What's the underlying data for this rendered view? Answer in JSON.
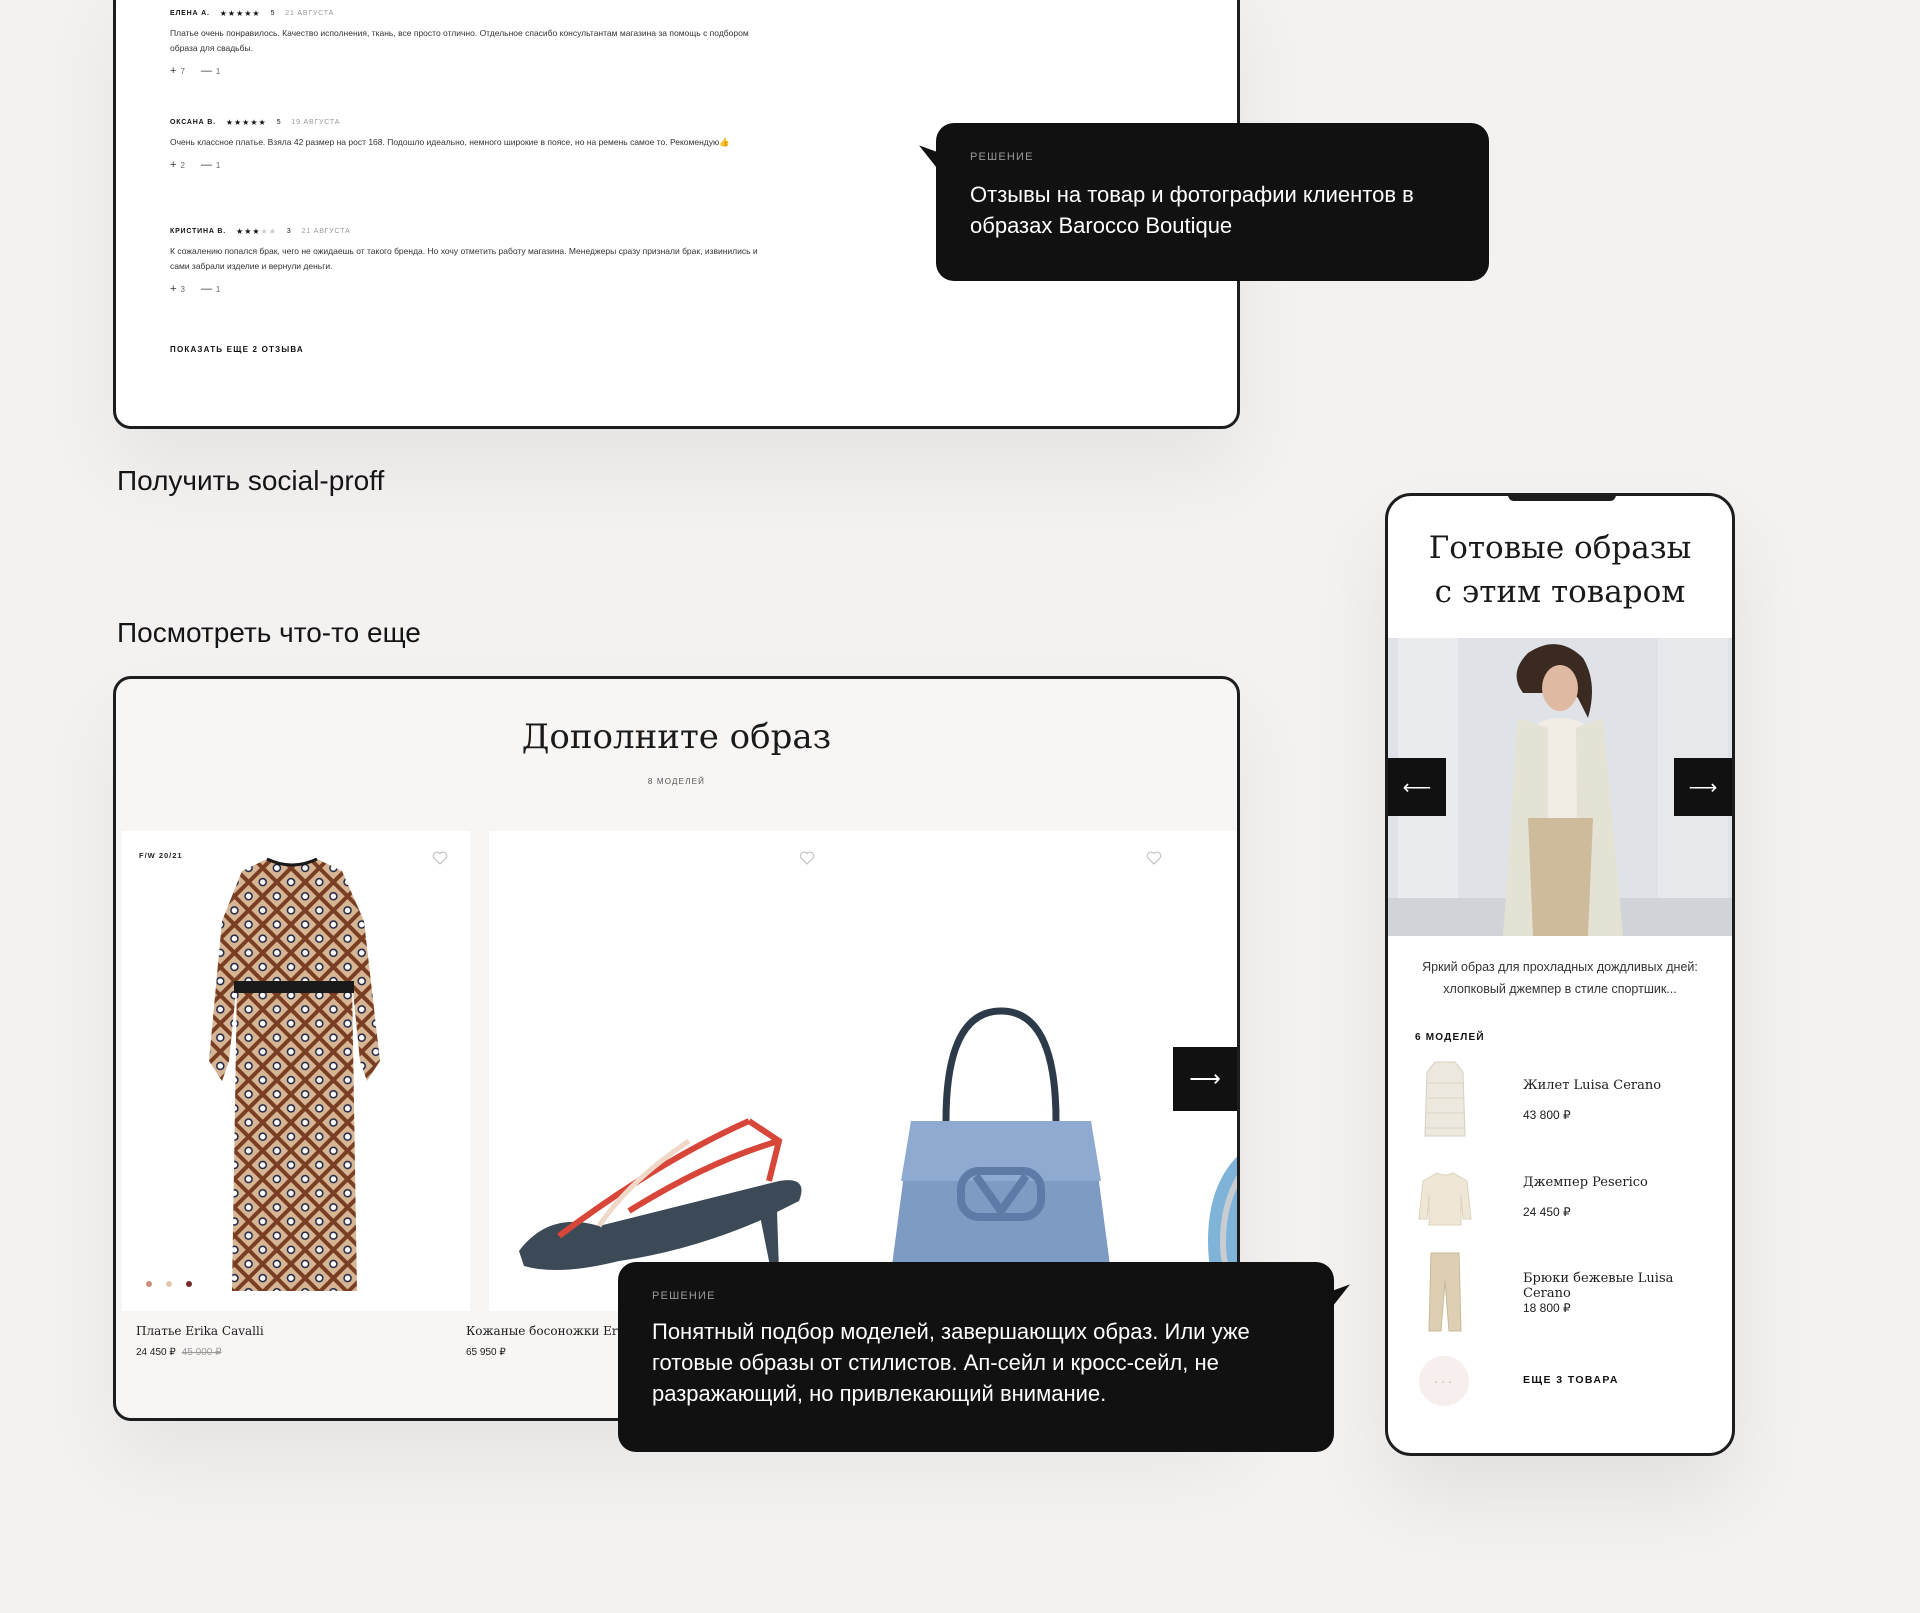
{
  "reviews": {
    "items": [
      {
        "name": "ЕЛЕНА А.",
        "stars": "★★★★★",
        "stars_off": "",
        "score": "5",
        "date": "21 АВГУСТА",
        "text": "Платье очень понравилось. Качество исполнения, ткань, все просто отлично. Отдельное спасибо консультантам магазина за помощь с подбором образа для свадьбы.",
        "likes": "7",
        "dislikes": "1"
      },
      {
        "name": "ОКСАНА В.",
        "stars": "★★★★★",
        "stars_off": "",
        "score": "5",
        "date": "19 АВГУСТА",
        "text": "Очень классное платье. Взяла 42 размер на рост 168. Подошло идеально, немного широкие в поясе, но на ремень самое то. Рекомендую👍",
        "likes": "2",
        "dislikes": "1"
      },
      {
        "name": "КРИСТИНА В.",
        "stars": "★★★",
        "stars_off": "★★",
        "score": "3",
        "date": "21 АВГУСТА",
        "text": "К сожалению попался брак, чего не ожидаешь от такого бренда. Но хочу отметить работу магазина. Менеджеры сразу признали брак, извинились и сами забрали изделие и вернули деньги.",
        "likes": "3",
        "dislikes": "1"
      }
    ],
    "show_more": "ПОКАЗАТЬ ЕЩЕ 2 ОТЗЫВА"
  },
  "tooltip1": {
    "label": "РЕШЕНИЕ",
    "text": "Отзывы на товар и фотографии клиентов в образах Barocco Boutique"
  },
  "tooltip2": {
    "label": "РЕШЕНИЕ",
    "text": "Понятный подбор моделей, завершающих образ. Или уже готовые образы от стилистов. Ап-сейл и кросс-сейл, не разражающий, но привлекающий внимание."
  },
  "sections": {
    "social": "Получить social-proff",
    "more": "Посмотреть что-то еще"
  },
  "look": {
    "title": "Дополните образ",
    "count": "8 МОДЕЛЕЙ",
    "season": "F/W 20/21",
    "products": [
      {
        "name": "Платье Erika Cavalli",
        "price": "24 450 ₽",
        "old_price": "45 000 ₽"
      },
      {
        "name": "Кожаные босоножки Erika Cavalli",
        "price": "65 950 ₽",
        "old_price": ""
      },
      {
        "name": "",
        "price": "",
        "old_price": ""
      }
    ],
    "color_dots": [
      "#c98f7c",
      "#e3c7b0",
      "#7a2a2e"
    ]
  },
  "phone": {
    "title": "Готовые образы\nс этим товаром",
    "description": "Яркий образ для прохладных дождливых дней: хлопковый джемпер в стиле спортшик...",
    "models_label": "6 МОДЕЛЕЙ",
    "items": [
      {
        "name": "Жилет Luisa Cerano",
        "price": "43 800 ₽"
      },
      {
        "name": "Джемпер Peserico",
        "price": "24 450 ₽"
      },
      {
        "name": "Брюки бежевые Luisa Cerano",
        "price": "18 800 ₽"
      }
    ],
    "more_label": "ЕЩЕ 3 ТОВАРА",
    "more_dots": "···",
    "arrow_left": "⟵",
    "arrow_right": "⟶"
  },
  "icons": {
    "plus": "+",
    "minus": "—",
    "next": "⟶"
  },
  "colors": {
    "background": "#f4f1f1",
    "tooltip_bg": "#111111",
    "frame_border": "#1d1d1d"
  }
}
